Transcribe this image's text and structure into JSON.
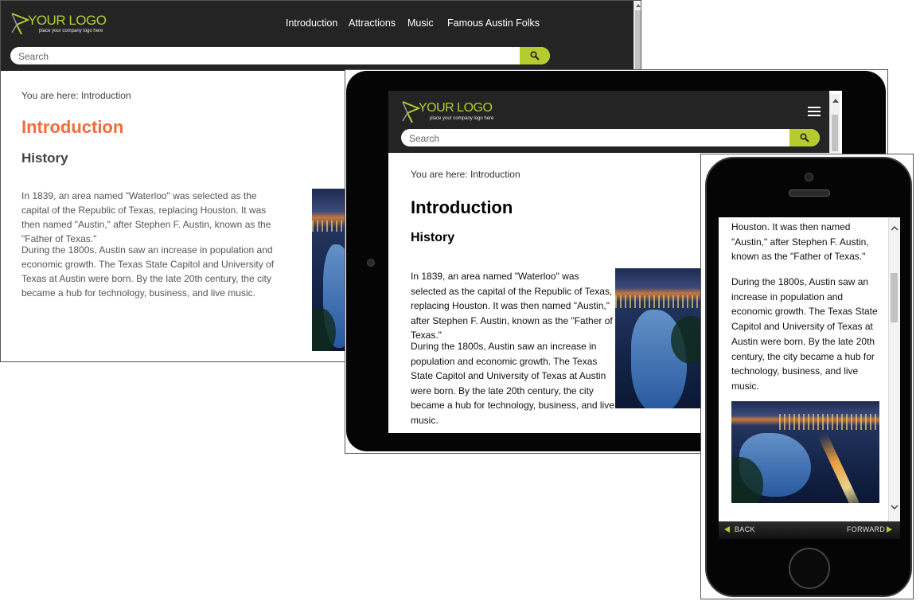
{
  "logo": {
    "text": "YOUR LOGO",
    "tagline": "place your company logo here"
  },
  "nav": [
    {
      "label": "Introduction"
    },
    {
      "label": "Attractions"
    },
    {
      "label": "Music"
    },
    {
      "label": "Famous Austin Folks"
    }
  ],
  "search": {
    "placeholder": "Search"
  },
  "page": {
    "breadcrumb": "You are here: Introduction",
    "title": "Introduction",
    "subtitle": "History",
    "paragraph1": "In 1839, an area named \"Waterloo\" was selected as the capital of the Republic of Texas, replacing Houston. It was then named \"Austin,\" after Stephen F. Austin, known as the \"Father of Texas.\"",
    "paragraph2": "During the 1800s, Austin saw an increase in population and economic growth. The Texas State Capitol and University of Texas at Austin were born. By the late 20th century, the city became a hub for technology, business, and live music."
  },
  "phone": {
    "paragraph1_tail": "Houston. It was then named \"Austin,\" after Stephen F. Austin, known as the \"Father of Texas.\"",
    "back_label": "BACK",
    "forward_label": "FORWARD"
  },
  "colors": {
    "accent": "#b5cc2e",
    "title_orange": "#f26b3a",
    "header_bg": "#242424"
  },
  "icons": {
    "search": "magnifier-icon",
    "menu": "hamburger-menu-icon",
    "back": "triangle-left-icon",
    "forward": "triangle-right-icon"
  }
}
